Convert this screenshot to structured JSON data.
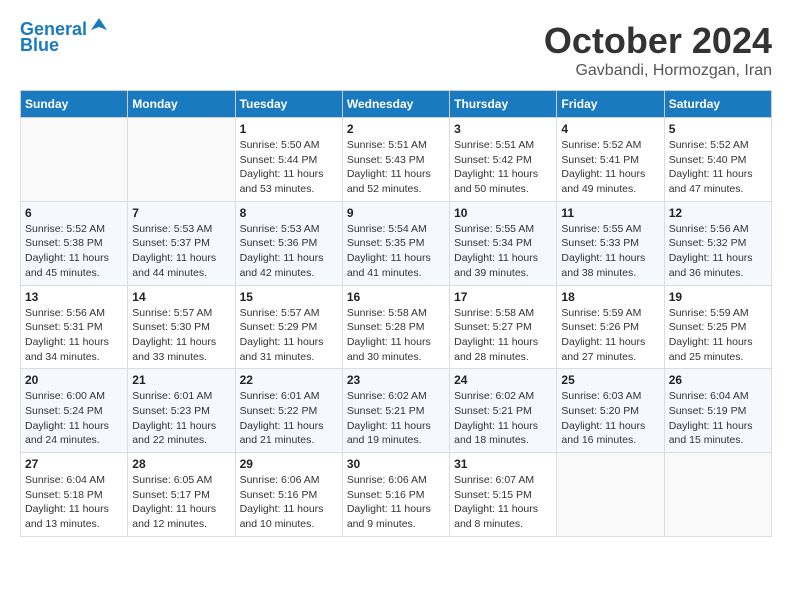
{
  "logo": {
    "line1": "General",
    "line2": "Blue"
  },
  "title": "October 2024",
  "subtitle": "Gavbandi, Hormozgan, Iran",
  "header": {
    "days": [
      "Sunday",
      "Monday",
      "Tuesday",
      "Wednesday",
      "Thursday",
      "Friday",
      "Saturday"
    ]
  },
  "weeks": [
    [
      {
        "day": "",
        "info": ""
      },
      {
        "day": "",
        "info": ""
      },
      {
        "day": "1",
        "info": "Sunrise: 5:50 AM\nSunset: 5:44 PM\nDaylight: 11 hours\nand 53 minutes."
      },
      {
        "day": "2",
        "info": "Sunrise: 5:51 AM\nSunset: 5:43 PM\nDaylight: 11 hours\nand 52 minutes."
      },
      {
        "day": "3",
        "info": "Sunrise: 5:51 AM\nSunset: 5:42 PM\nDaylight: 11 hours\nand 50 minutes."
      },
      {
        "day": "4",
        "info": "Sunrise: 5:52 AM\nSunset: 5:41 PM\nDaylight: 11 hours\nand 49 minutes."
      },
      {
        "day": "5",
        "info": "Sunrise: 5:52 AM\nSunset: 5:40 PM\nDaylight: 11 hours\nand 47 minutes."
      }
    ],
    [
      {
        "day": "6",
        "info": "Sunrise: 5:52 AM\nSunset: 5:38 PM\nDaylight: 11 hours\nand 45 minutes."
      },
      {
        "day": "7",
        "info": "Sunrise: 5:53 AM\nSunset: 5:37 PM\nDaylight: 11 hours\nand 44 minutes."
      },
      {
        "day": "8",
        "info": "Sunrise: 5:53 AM\nSunset: 5:36 PM\nDaylight: 11 hours\nand 42 minutes."
      },
      {
        "day": "9",
        "info": "Sunrise: 5:54 AM\nSunset: 5:35 PM\nDaylight: 11 hours\nand 41 minutes."
      },
      {
        "day": "10",
        "info": "Sunrise: 5:55 AM\nSunset: 5:34 PM\nDaylight: 11 hours\nand 39 minutes."
      },
      {
        "day": "11",
        "info": "Sunrise: 5:55 AM\nSunset: 5:33 PM\nDaylight: 11 hours\nand 38 minutes."
      },
      {
        "day": "12",
        "info": "Sunrise: 5:56 AM\nSunset: 5:32 PM\nDaylight: 11 hours\nand 36 minutes."
      }
    ],
    [
      {
        "day": "13",
        "info": "Sunrise: 5:56 AM\nSunset: 5:31 PM\nDaylight: 11 hours\nand 34 minutes."
      },
      {
        "day": "14",
        "info": "Sunrise: 5:57 AM\nSunset: 5:30 PM\nDaylight: 11 hours\nand 33 minutes."
      },
      {
        "day": "15",
        "info": "Sunrise: 5:57 AM\nSunset: 5:29 PM\nDaylight: 11 hours\nand 31 minutes."
      },
      {
        "day": "16",
        "info": "Sunrise: 5:58 AM\nSunset: 5:28 PM\nDaylight: 11 hours\nand 30 minutes."
      },
      {
        "day": "17",
        "info": "Sunrise: 5:58 AM\nSunset: 5:27 PM\nDaylight: 11 hours\nand 28 minutes."
      },
      {
        "day": "18",
        "info": "Sunrise: 5:59 AM\nSunset: 5:26 PM\nDaylight: 11 hours\nand 27 minutes."
      },
      {
        "day": "19",
        "info": "Sunrise: 5:59 AM\nSunset: 5:25 PM\nDaylight: 11 hours\nand 25 minutes."
      }
    ],
    [
      {
        "day": "20",
        "info": "Sunrise: 6:00 AM\nSunset: 5:24 PM\nDaylight: 11 hours\nand 24 minutes."
      },
      {
        "day": "21",
        "info": "Sunrise: 6:01 AM\nSunset: 5:23 PM\nDaylight: 11 hours\nand 22 minutes."
      },
      {
        "day": "22",
        "info": "Sunrise: 6:01 AM\nSunset: 5:22 PM\nDaylight: 11 hours\nand 21 minutes."
      },
      {
        "day": "23",
        "info": "Sunrise: 6:02 AM\nSunset: 5:21 PM\nDaylight: 11 hours\nand 19 minutes."
      },
      {
        "day": "24",
        "info": "Sunrise: 6:02 AM\nSunset: 5:21 PM\nDaylight: 11 hours\nand 18 minutes."
      },
      {
        "day": "25",
        "info": "Sunrise: 6:03 AM\nSunset: 5:20 PM\nDaylight: 11 hours\nand 16 minutes."
      },
      {
        "day": "26",
        "info": "Sunrise: 6:04 AM\nSunset: 5:19 PM\nDaylight: 11 hours\nand 15 minutes."
      }
    ],
    [
      {
        "day": "27",
        "info": "Sunrise: 6:04 AM\nSunset: 5:18 PM\nDaylight: 11 hours\nand 13 minutes."
      },
      {
        "day": "28",
        "info": "Sunrise: 6:05 AM\nSunset: 5:17 PM\nDaylight: 11 hours\nand 12 minutes."
      },
      {
        "day": "29",
        "info": "Sunrise: 6:06 AM\nSunset: 5:16 PM\nDaylight: 11 hours\nand 10 minutes."
      },
      {
        "day": "30",
        "info": "Sunrise: 6:06 AM\nSunset: 5:16 PM\nDaylight: 11 hours\nand 9 minutes."
      },
      {
        "day": "31",
        "info": "Sunrise: 6:07 AM\nSunset: 5:15 PM\nDaylight: 11 hours\nand 8 minutes."
      },
      {
        "day": "",
        "info": ""
      },
      {
        "day": "",
        "info": ""
      }
    ]
  ]
}
